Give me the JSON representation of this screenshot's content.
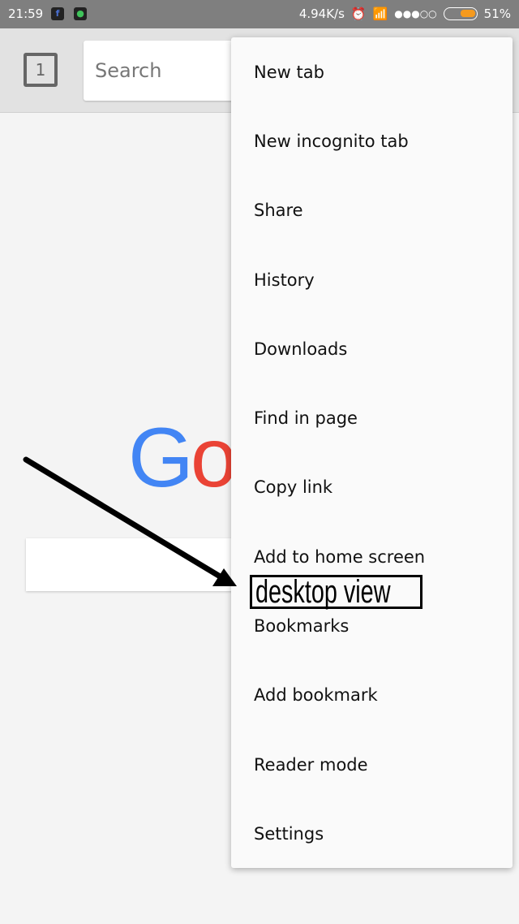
{
  "status_bar": {
    "time": "21:59",
    "speed": "4.94K/s",
    "battery": "51%",
    "apps": [
      "facebook-icon",
      "whatsapp-icon"
    ]
  },
  "toolbar": {
    "tab_count": "1",
    "search_placeholder": "Search"
  },
  "page": {
    "logo_partial": "Go"
  },
  "menu": {
    "items": [
      "New tab",
      "New incognito tab",
      "Share",
      "History",
      "Downloads",
      "Find in page",
      "Copy link",
      "Add to home screen",
      "Bookmarks",
      "Add bookmark",
      "Reader mode",
      "Settings"
    ]
  },
  "annotation": {
    "label": "desktop view"
  },
  "colors": {
    "battery": "#f59a1e",
    "google_blue": "#4285f4",
    "google_red": "#ea4335"
  }
}
